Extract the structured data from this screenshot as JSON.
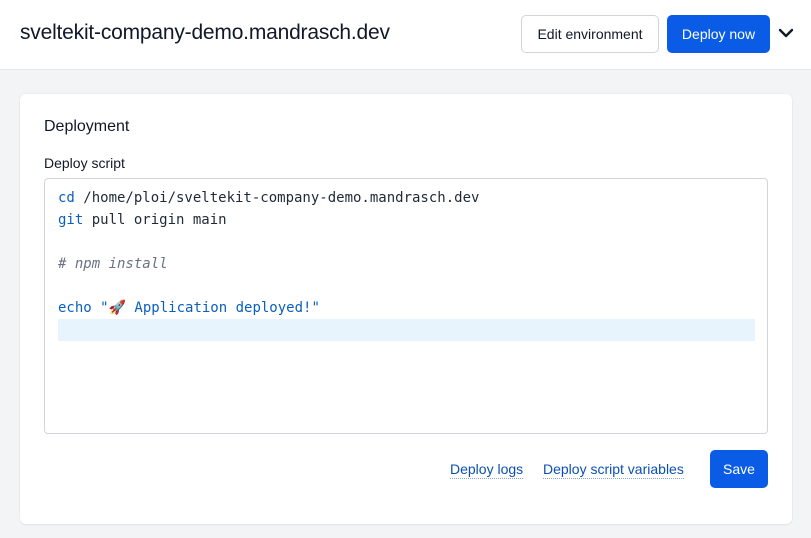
{
  "header": {
    "title": "sveltekit-company-demo.mandrasch.dev",
    "edit_env_label": "Edit environment",
    "deploy_now_label": "Deploy now",
    "dropdown_icon": "chevron-down-icon"
  },
  "deployment": {
    "title": "Deployment",
    "script_label": "Deploy script",
    "script_lines": [
      {
        "cmd": "cd",
        "rest": " /home/ploi/sveltekit-company-demo.mandrasch.dev"
      },
      {
        "cmd": "git",
        "rest": " pull origin main"
      },
      {
        "text": ""
      },
      {
        "comment": "# npm install"
      },
      {
        "text": ""
      },
      {
        "cmd": "echo",
        "rest": " \"🚀 Application deployed!\""
      },
      {
        "text": ""
      }
    ],
    "links": {
      "deploy_logs": "Deploy logs",
      "script_variables": "Deploy script variables"
    },
    "save_label": "Save"
  },
  "colors": {
    "primary": "#0a5ce6",
    "link": "#0b4fb3",
    "keyword": "#0b5fbf",
    "active_line": "#e8f4fd"
  }
}
